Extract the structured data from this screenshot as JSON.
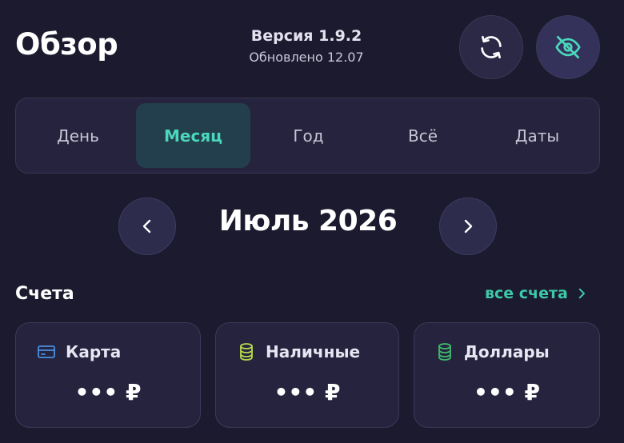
{
  "header": {
    "title": "Обзор",
    "version": "Версия 1.9.2",
    "updated": "Обновлено 12.07",
    "refresh_icon": "refresh-icon",
    "hide_icon": "eye-off-icon"
  },
  "tabs": [
    {
      "label": "День",
      "active": false
    },
    {
      "label": "Месяц",
      "active": true
    },
    {
      "label": "Год",
      "active": false
    },
    {
      "label": "Всё",
      "active": false
    },
    {
      "label": "Даты",
      "active": false
    }
  ],
  "period": {
    "label": "Июль 2026",
    "prev_icon": "chevron-left-icon",
    "next_icon": "chevron-right-icon"
  },
  "accounts": {
    "title": "Счета",
    "all_link": "все счета",
    "items": [
      {
        "name": "Карта",
        "amount": "••• ₽",
        "icon": "credit-card-icon",
        "icon_color": "#4a90e2"
      },
      {
        "name": "Наличные",
        "amount": "••• ₽",
        "icon": "coins-icon",
        "icon_color": "#b5d94a"
      },
      {
        "name": "Доллары",
        "amount": "••• ₽",
        "icon": "coins-icon",
        "icon_color": "#3fba6b"
      }
    ]
  },
  "colors": {
    "background": "#1c1a2e",
    "accent": "#4ad7bd",
    "card": "#25233d"
  }
}
